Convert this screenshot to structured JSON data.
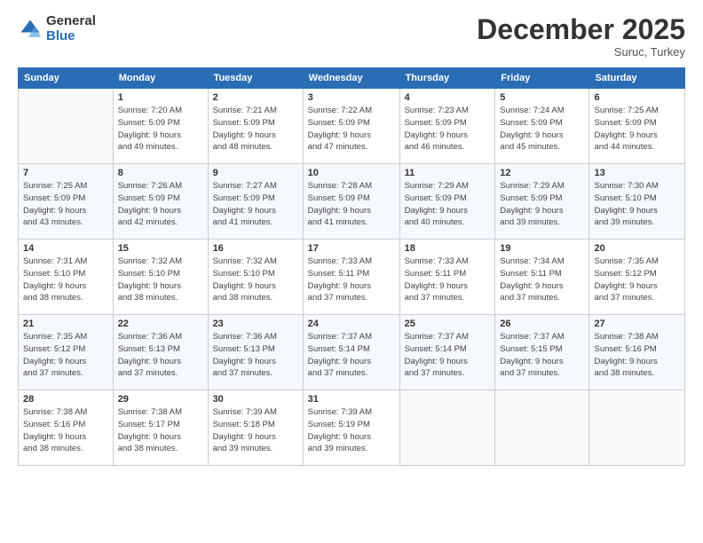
{
  "logo": {
    "general": "General",
    "blue": "Blue"
  },
  "title": "December 2025",
  "subtitle": "Suruc, Turkey",
  "days_of_week": [
    "Sunday",
    "Monday",
    "Tuesday",
    "Wednesday",
    "Thursday",
    "Friday",
    "Saturday"
  ],
  "weeks": [
    [
      {
        "day": "",
        "info": ""
      },
      {
        "day": "1",
        "info": "Sunrise: 7:20 AM\nSunset: 5:09 PM\nDaylight: 9 hours\nand 49 minutes."
      },
      {
        "day": "2",
        "info": "Sunrise: 7:21 AM\nSunset: 5:09 PM\nDaylight: 9 hours\nand 48 minutes."
      },
      {
        "day": "3",
        "info": "Sunrise: 7:22 AM\nSunset: 5:09 PM\nDaylight: 9 hours\nand 47 minutes."
      },
      {
        "day": "4",
        "info": "Sunrise: 7:23 AM\nSunset: 5:09 PM\nDaylight: 9 hours\nand 46 minutes."
      },
      {
        "day": "5",
        "info": "Sunrise: 7:24 AM\nSunset: 5:09 PM\nDaylight: 9 hours\nand 45 minutes."
      },
      {
        "day": "6",
        "info": "Sunrise: 7:25 AM\nSunset: 5:09 PM\nDaylight: 9 hours\nand 44 minutes."
      }
    ],
    [
      {
        "day": "7",
        "info": "Sunrise: 7:25 AM\nSunset: 5:09 PM\nDaylight: 9 hours\nand 43 minutes."
      },
      {
        "day": "8",
        "info": "Sunrise: 7:26 AM\nSunset: 5:09 PM\nDaylight: 9 hours\nand 42 minutes."
      },
      {
        "day": "9",
        "info": "Sunrise: 7:27 AM\nSunset: 5:09 PM\nDaylight: 9 hours\nand 41 minutes."
      },
      {
        "day": "10",
        "info": "Sunrise: 7:28 AM\nSunset: 5:09 PM\nDaylight: 9 hours\nand 41 minutes."
      },
      {
        "day": "11",
        "info": "Sunrise: 7:29 AM\nSunset: 5:09 PM\nDaylight: 9 hours\nand 40 minutes."
      },
      {
        "day": "12",
        "info": "Sunrise: 7:29 AM\nSunset: 5:09 PM\nDaylight: 9 hours\nand 39 minutes."
      },
      {
        "day": "13",
        "info": "Sunrise: 7:30 AM\nSunset: 5:10 PM\nDaylight: 9 hours\nand 39 minutes."
      }
    ],
    [
      {
        "day": "14",
        "info": "Sunrise: 7:31 AM\nSunset: 5:10 PM\nDaylight: 9 hours\nand 38 minutes."
      },
      {
        "day": "15",
        "info": "Sunrise: 7:32 AM\nSunset: 5:10 PM\nDaylight: 9 hours\nand 38 minutes."
      },
      {
        "day": "16",
        "info": "Sunrise: 7:32 AM\nSunset: 5:10 PM\nDaylight: 9 hours\nand 38 minutes."
      },
      {
        "day": "17",
        "info": "Sunrise: 7:33 AM\nSunset: 5:11 PM\nDaylight: 9 hours\nand 37 minutes."
      },
      {
        "day": "18",
        "info": "Sunrise: 7:33 AM\nSunset: 5:11 PM\nDaylight: 9 hours\nand 37 minutes."
      },
      {
        "day": "19",
        "info": "Sunrise: 7:34 AM\nSunset: 5:11 PM\nDaylight: 9 hours\nand 37 minutes."
      },
      {
        "day": "20",
        "info": "Sunrise: 7:35 AM\nSunset: 5:12 PM\nDaylight: 9 hours\nand 37 minutes."
      }
    ],
    [
      {
        "day": "21",
        "info": "Sunrise: 7:35 AM\nSunset: 5:12 PM\nDaylight: 9 hours\nand 37 minutes."
      },
      {
        "day": "22",
        "info": "Sunrise: 7:36 AM\nSunset: 5:13 PM\nDaylight: 9 hours\nand 37 minutes."
      },
      {
        "day": "23",
        "info": "Sunrise: 7:36 AM\nSunset: 5:13 PM\nDaylight: 9 hours\nand 37 minutes."
      },
      {
        "day": "24",
        "info": "Sunrise: 7:37 AM\nSunset: 5:14 PM\nDaylight: 9 hours\nand 37 minutes."
      },
      {
        "day": "25",
        "info": "Sunrise: 7:37 AM\nSunset: 5:14 PM\nDaylight: 9 hours\nand 37 minutes."
      },
      {
        "day": "26",
        "info": "Sunrise: 7:37 AM\nSunset: 5:15 PM\nDaylight: 9 hours\nand 37 minutes."
      },
      {
        "day": "27",
        "info": "Sunrise: 7:38 AM\nSunset: 5:16 PM\nDaylight: 9 hours\nand 38 minutes."
      }
    ],
    [
      {
        "day": "28",
        "info": "Sunrise: 7:38 AM\nSunset: 5:16 PM\nDaylight: 9 hours\nand 38 minutes."
      },
      {
        "day": "29",
        "info": "Sunrise: 7:38 AM\nSunset: 5:17 PM\nDaylight: 9 hours\nand 38 minutes."
      },
      {
        "day": "30",
        "info": "Sunrise: 7:39 AM\nSunset: 5:18 PM\nDaylight: 9 hours\nand 39 minutes."
      },
      {
        "day": "31",
        "info": "Sunrise: 7:39 AM\nSunset: 5:19 PM\nDaylight: 9 hours\nand 39 minutes."
      },
      {
        "day": "",
        "info": ""
      },
      {
        "day": "",
        "info": ""
      },
      {
        "day": "",
        "info": ""
      }
    ]
  ]
}
